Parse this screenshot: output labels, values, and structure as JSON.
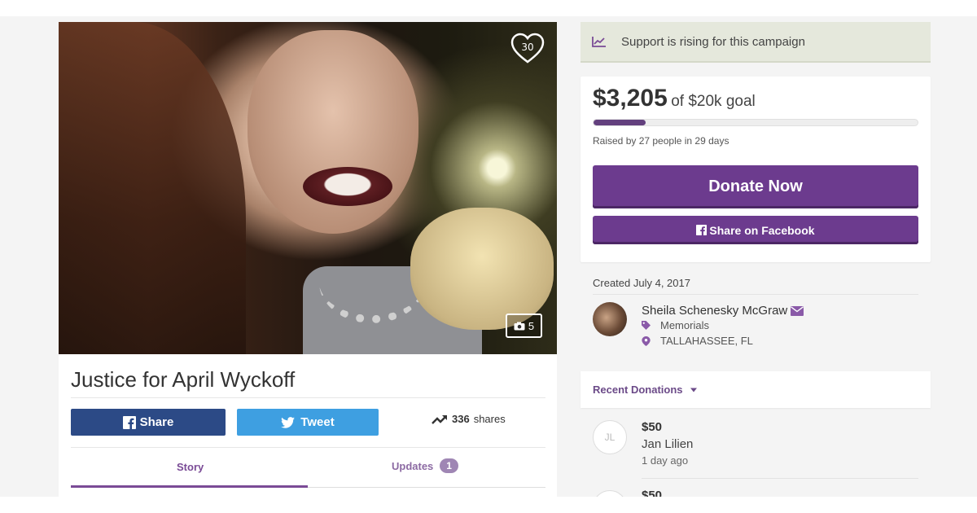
{
  "campaign": {
    "title": "Justice for April Wyckoff",
    "heart_count": "30",
    "photo_count": "5"
  },
  "share": {
    "facebook_label": "Share",
    "twitter_label": "Tweet",
    "shares_count": "336",
    "shares_label": "shares"
  },
  "tabs": [
    {
      "label": "Story",
      "active": true
    },
    {
      "label": "Updates",
      "badge": "1"
    }
  ],
  "banner": {
    "text": "Support is rising for this campaign"
  },
  "funding": {
    "raised": "$3,205",
    "goal_text": "of $20k goal",
    "progress_fraction": 0.16,
    "summary": "Raised by 27 people in 29 days",
    "donate_label": "Donate Now",
    "share_facebook_label": "Share on Facebook"
  },
  "organizer": {
    "created": "Created July 4, 2017",
    "name": "Sheila Schenesky McGraw",
    "category": "Memorials",
    "location": "TALLAHASSEE, FL"
  },
  "recent_donations": {
    "heading": "Recent Donations",
    "items": [
      {
        "initials": "JL",
        "amount": "$50",
        "name": "Jan Lilien",
        "time": "1 day ago"
      },
      {
        "amount": "$50"
      }
    ]
  },
  "colors": {
    "brand_purple": "#6c3b8e",
    "facebook_blue": "#2c4a86",
    "twitter_blue": "#3e9fe1",
    "banner_bg": "#e5e8dc"
  }
}
